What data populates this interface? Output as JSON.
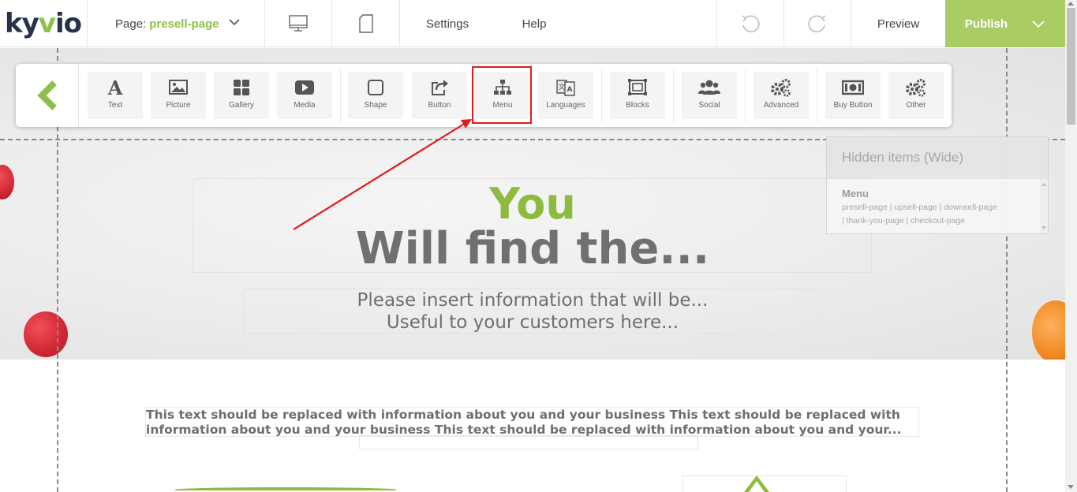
{
  "logo": {
    "prefix": "ky",
    "v": "v",
    "suffix": "io"
  },
  "topbar": {
    "page_label": "Page:",
    "page_value": "presell-page",
    "settings": "Settings",
    "help": "Help",
    "preview": "Preview",
    "publish": "Publish"
  },
  "toolbar": {
    "items": [
      {
        "label": "Text",
        "icon": "text-icon"
      },
      {
        "label": "Picture",
        "icon": "picture-icon"
      },
      {
        "label": "Gallery",
        "icon": "gallery-icon"
      },
      {
        "label": "Media",
        "icon": "media-icon"
      },
      {
        "label": "Shape",
        "icon": "shape-icon"
      },
      {
        "label": "Button",
        "icon": "button-icon"
      },
      {
        "label": "Menu",
        "icon": "menu-icon"
      },
      {
        "label": "Languages",
        "icon": "languages-icon"
      },
      {
        "label": "Blocks",
        "icon": "blocks-icon"
      },
      {
        "label": "Social",
        "icon": "social-icon"
      },
      {
        "label": "Advanced",
        "icon": "advanced-icon"
      },
      {
        "label": "Buy Button",
        "icon": "buy-button-icon"
      },
      {
        "label": "Other",
        "icon": "other-icon"
      }
    ]
  },
  "hidden_panel": {
    "title": "Hidden items (Wide)",
    "menu_label": "Menu",
    "links_line1": "presell-page | upsell-page | downsell-page",
    "links_line2": "| thank-you-page | checkout-page"
  },
  "hero": {
    "you": "You",
    "headline": "Will find the...",
    "sub1": "Please insert information that will be...",
    "sub2": "Useful to your customers here..."
  },
  "body": {
    "paragraph": "This text should be replaced with information about you and your business This text should be replaced with information about you and your business This text should be replaced with information about you and your..."
  },
  "colors": {
    "brand_green": "#8dc04b",
    "publish_bg": "#a9cc64",
    "highlight_red": "#e01b1b"
  }
}
